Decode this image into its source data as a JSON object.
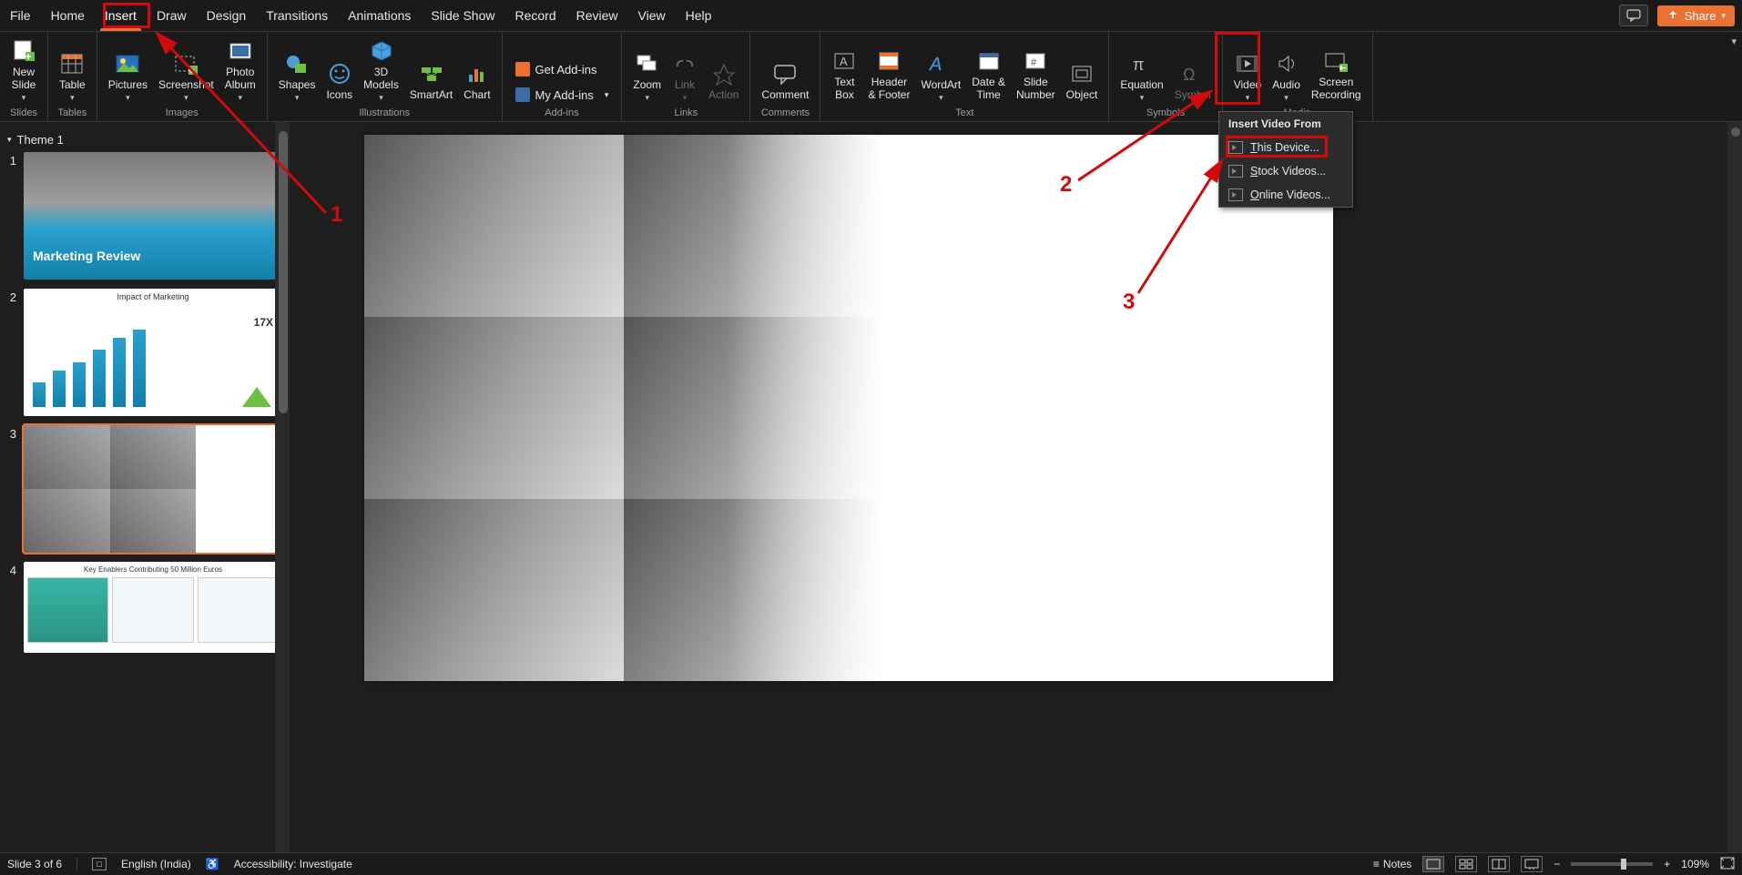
{
  "tabs": {
    "file": "File",
    "home": "Home",
    "insert": "Insert",
    "draw": "Draw",
    "design": "Design",
    "transitions": "Transitions",
    "animations": "Animations",
    "slideshow": "Slide Show",
    "record": "Record",
    "review": "Review",
    "view": "View",
    "help": "Help"
  },
  "share": {
    "label": "Share"
  },
  "ribbon": {
    "groups": {
      "slides": "Slides",
      "tables": "Tables",
      "images": "Images",
      "illustrations": "Illustrations",
      "addins": "Add-ins",
      "links": "Links",
      "comments": "Comments",
      "text": "Text",
      "symbols": "Symbols",
      "media": "Media"
    },
    "buttons": {
      "new_slide": "New\nSlide",
      "table": "Table",
      "pictures": "Pictures",
      "screenshot": "Screenshot",
      "photo_album": "Photo\nAlbum",
      "shapes": "Shapes",
      "icons": "Icons",
      "models3d": "3D\nModels",
      "smartart": "SmartArt",
      "chart": "Chart",
      "get_addins": "Get Add-ins",
      "my_addins": "My Add-ins",
      "zoom": "Zoom",
      "link": "Link",
      "action": "Action",
      "comment": "Comment",
      "text_box": "Text\nBox",
      "header_footer": "Header\n& Footer",
      "wordart": "WordArt",
      "date_time": "Date &\nTime",
      "slide_number": "Slide\nNumber",
      "object": "Object",
      "equation": "Equation",
      "symbol": "Symbol",
      "video": "Video",
      "audio": "Audio",
      "screen_recording": "Screen\nRecording"
    }
  },
  "video_menu": {
    "header": "Insert Video From",
    "this_device": "This Device...",
    "stock": "Stock Videos...",
    "online": "Online Videos...",
    "this_device_accel": "T",
    "stock_accel": "S",
    "online_accel": "O"
  },
  "sidebar": {
    "section": "Theme 1",
    "slides": {
      "s1": {
        "num": "1",
        "title": "Marketing Review"
      },
      "s2": {
        "num": "2",
        "title": "Impact of Marketing",
        "multiplier": "17X"
      },
      "s3": {
        "num": "3"
      },
      "s4": {
        "num": "4",
        "title": "Key Enablers Contributing 50 Million Euros"
      }
    }
  },
  "status": {
    "slide_of": "Slide 3 of 6",
    "language": "English (India)",
    "accessibility": "Accessibility: Investigate",
    "notes": "Notes",
    "zoom": "109%"
  },
  "annotations": {
    "a1": "1",
    "a2": "2",
    "a3": "3"
  }
}
